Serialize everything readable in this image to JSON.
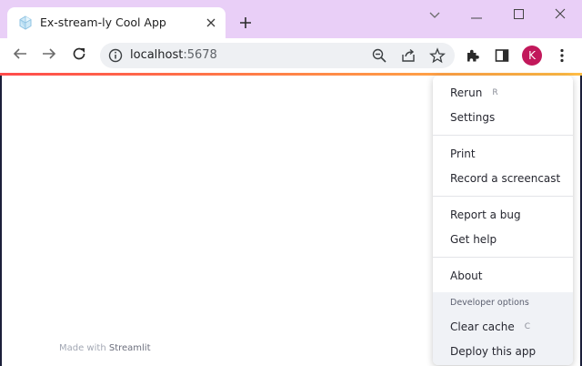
{
  "browser": {
    "tab_title": "Ex-stream-ly Cool App",
    "url_host": "localhost",
    "url_port": ":5678",
    "profile_initial": "K",
    "icons": {
      "favicon": "streamlit-favicon-icon",
      "tab_close": "close-icon",
      "new_tab": "plus-icon",
      "tab_search": "chevron-down-icon",
      "minimize": "minimize-icon",
      "maximize": "maximize-icon",
      "close_window": "close-icon",
      "back": "arrow-left-icon",
      "forward": "arrow-right-icon",
      "reload": "reload-icon",
      "site_info": "info-icon",
      "zoom": "zoom-out-icon",
      "share": "share-icon",
      "bookmark": "star-icon",
      "extensions": "puzzle-icon",
      "side_panel": "side-panel-icon",
      "menu": "kebab-menu-icon"
    }
  },
  "app": {
    "footer_prefix": "Made with ",
    "footer_brand": "Streamlit"
  },
  "menu": {
    "items": [
      {
        "label": "Rerun",
        "shortcut": "R"
      },
      {
        "label": "Settings"
      },
      {
        "label": "Print"
      },
      {
        "label": "Record a screencast"
      },
      {
        "label": "Report a bug"
      },
      {
        "label": "Get help"
      },
      {
        "label": "About"
      }
    ],
    "developer": {
      "heading": "Developer options",
      "items": [
        {
          "label": "Clear cache",
          "shortcut": "C"
        },
        {
          "label": "Deploy this app"
        }
      ]
    }
  },
  "colors": {
    "tabbar": "#e9cff7",
    "accent_start": "#ff4b4b",
    "accent_end": "#ffbd45",
    "avatar": "#c2185b"
  }
}
